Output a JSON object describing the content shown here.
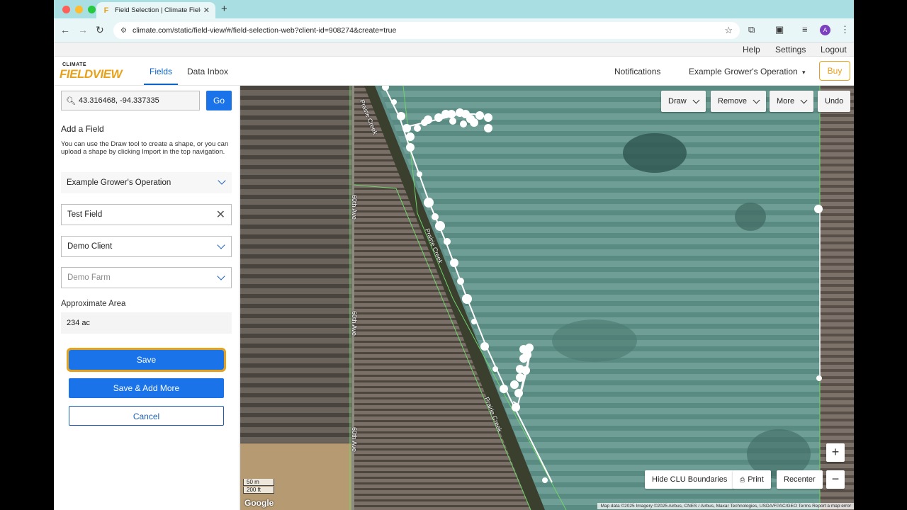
{
  "browser": {
    "tab_title": "Field Selection | Climate Field",
    "url": "climate.com/static/field-view/#/field-selection-web?client-id=908274&create=true",
    "avatar_initial": "A"
  },
  "utility_nav": {
    "help": "Help",
    "settings": "Settings",
    "logout": "Logout"
  },
  "header": {
    "logo_top": "CLIMATE",
    "logo_main": "FIELDVIEW",
    "tabs": [
      {
        "label": "Fields"
      },
      {
        "label": "Data Inbox"
      }
    ],
    "notifications": "Notifications",
    "operation": "Example Grower's Operation",
    "buy": "Buy"
  },
  "sidebar": {
    "search_value": "43.316468, -94.337335",
    "go_label": "Go",
    "add_field_title": "Add a Field",
    "help_text": "You can use the Draw tool to create a shape, or you can upload a shape by clicking Import in the top navigation.",
    "operation_select": "Example Grower's Operation",
    "field_name": "Test Field",
    "client_select": "Demo Client",
    "farm_placeholder": "Demo Farm",
    "area_label": "Approximate Area",
    "area_value": "234 ac",
    "save_label": "Save",
    "save_add_label": "Save & Add More",
    "cancel_label": "Cancel"
  },
  "map": {
    "tools": {
      "draw": "Draw",
      "remove": "Remove",
      "more": "More",
      "undo": "Undo"
    },
    "bottom": {
      "hide_clu": "Hide CLU Boundaries",
      "print": "Print",
      "recenter": "Recenter"
    },
    "zoom_in": "+",
    "zoom_out": "−",
    "scale_m": "50 m",
    "scale_ft": "200 ft",
    "google": "Google",
    "attribution": "Map data ©2025 Imagery ©2025 Airbus, CNES / Airbus, Maxar Technologies, USDA/FPAC/GEO   Terms   Report a map error",
    "road_labels": {
      "creek": "Prairie Creek",
      "ave": "60th Ave"
    }
  }
}
